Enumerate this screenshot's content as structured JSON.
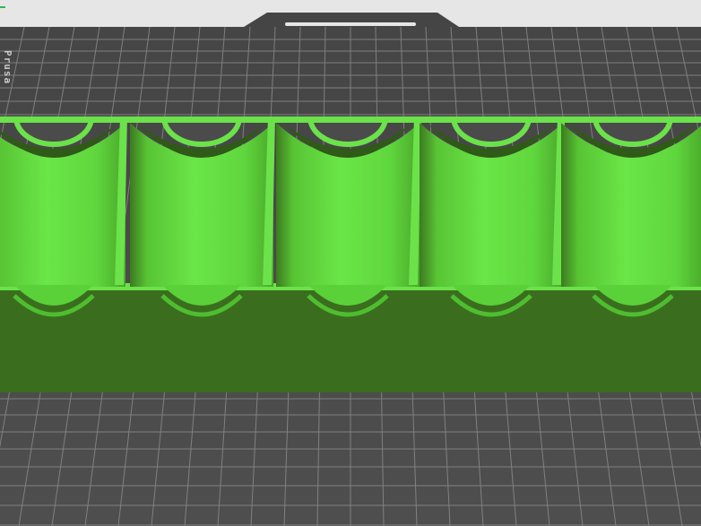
{
  "viewport": {
    "bed_color": "#4b4b4b",
    "grid_color": "#8a8a8a",
    "background_color": "#e6e6e6",
    "bed_logo_text": "Prusa"
  },
  "model": {
    "name_icon": "battery-holder-model",
    "slot_count": 5,
    "colors": {
      "light": "#6be24a",
      "mid": "#5ad139",
      "dark": "#3a6e1e",
      "shadow": "#2f5a17"
    }
  }
}
